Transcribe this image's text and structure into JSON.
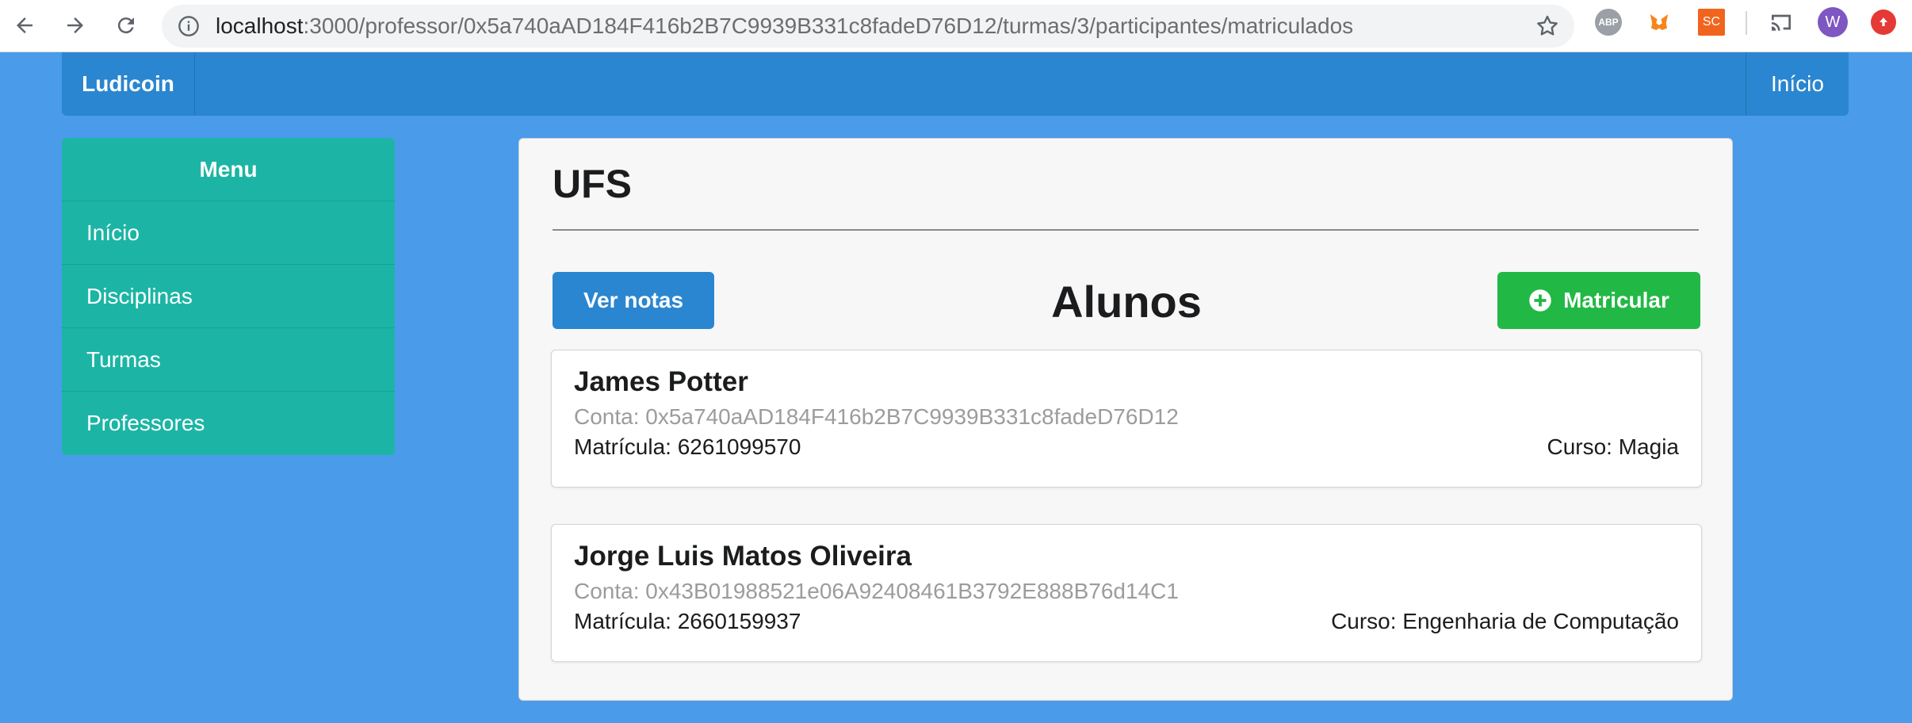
{
  "browser": {
    "url_host": "localhost",
    "url_path": ":3000/professor/0x5a740aAD184F416b2B7C9939B331c8fadeD76D12/turmas/3/participantes/matriculados",
    "extensions": [
      "abp-icon",
      "metamask-fox-icon",
      "sc-icon",
      "cast-icon",
      "profile-avatar",
      "update-icon"
    ],
    "abp_label": "ABP",
    "sc_label": "SC",
    "profile_initial": "W"
  },
  "navbar": {
    "brand": "Ludicoin",
    "right_link": "Início"
  },
  "menu": {
    "header": "Menu",
    "items": [
      {
        "label": "Início"
      },
      {
        "label": "Disciplinas"
      },
      {
        "label": "Turmas"
      },
      {
        "label": "Professores"
      }
    ]
  },
  "panel": {
    "title": "UFS",
    "section_title": "Alunos",
    "ver_notas_label": "Ver notas",
    "matricular_label": "Matricular"
  },
  "students": [
    {
      "name": "James Potter",
      "conta": "Conta: 0x5a740aAD184F416b2B7C9939B331c8fadeD76D12",
      "matricula": "Matrícula: 6261099570",
      "curso": "Curso: Magia"
    },
    {
      "name": "Jorge Luis Matos Oliveira",
      "conta": "Conta: 0x43B01988521e06A92408461B3792E888B76d14C1",
      "matricula": "Matrícula: 2660159937",
      "curso": "Curso: Engenharia de Computação"
    }
  ],
  "colors": {
    "page_background": "#4a9bea",
    "navbar": "#2a86d0",
    "menu": "#1cb5a5",
    "primary_button": "#2a86d0",
    "success_button": "#22b845"
  }
}
